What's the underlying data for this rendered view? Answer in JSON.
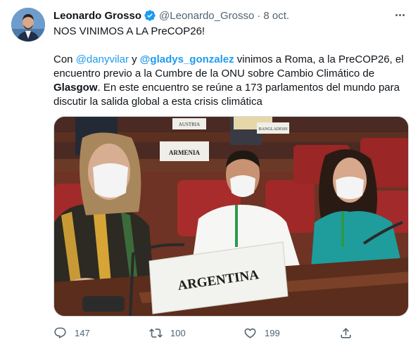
{
  "author": {
    "name": "Leonardo Grosso",
    "handle": "@Leonardo_Grosso",
    "separator": "·",
    "date": "8 oct."
  },
  "tweet": {
    "line1": "NOS VINIMOS A LA PreCOP26!",
    "p2_part1": "Con ",
    "mention1": "@danyvilar",
    "p2_part2": " y ",
    "mention2": "@gladys_gonzalez",
    "p2_part3": " vinimos a Roma, a la PreCOP26, el encuentro previo a la Cumbre de la ONU sobre Cambio Climático de ",
    "bold_word": "Glasgow",
    "p2_part4": ". En este encuentro se reúne a 173 parlamentos del mundo para discutir la salida global a esta crisis climática"
  },
  "photo": {
    "placard_main": "ARGENTINA",
    "placard_armenia": "ARMENIA",
    "placard_austria": "AUSTRIA",
    "placard_bangladesh": "BANGLADESH"
  },
  "actions": {
    "reply_count": "147",
    "retweet_count": "100",
    "like_count": "199"
  },
  "colors": {
    "accent": "#1d9bf0",
    "text": "#0f1419",
    "secondary": "#536471"
  }
}
